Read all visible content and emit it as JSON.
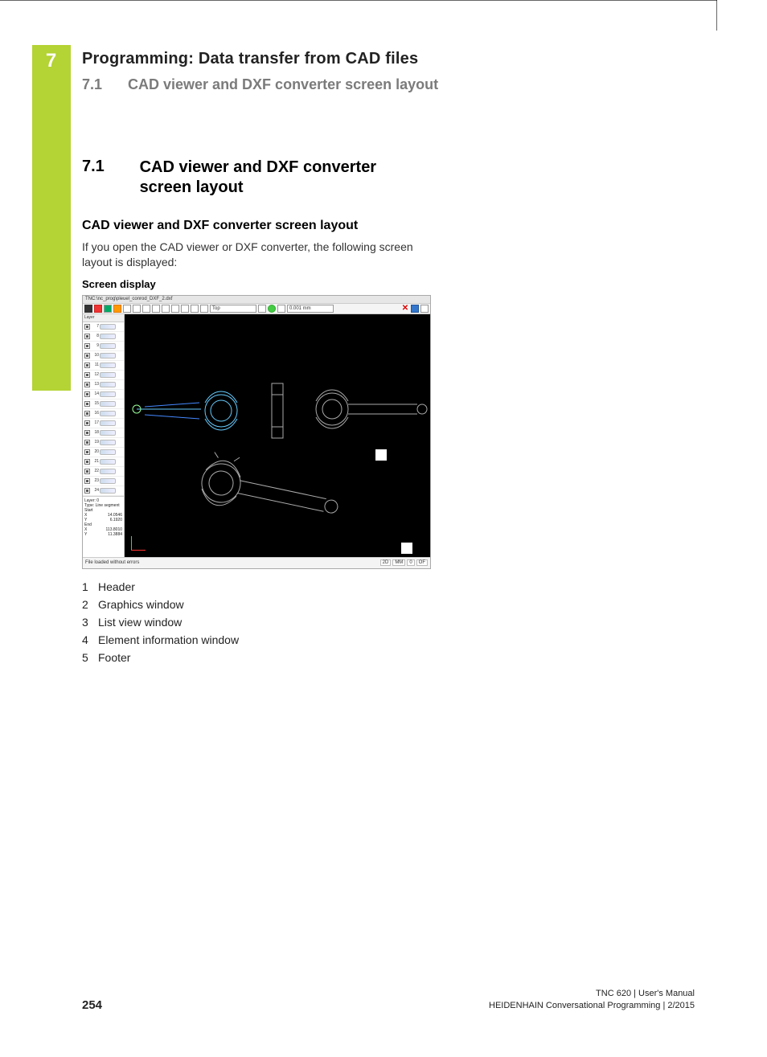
{
  "chapter_number": "7",
  "header": {
    "title": "Programming: Data transfer from CAD files",
    "sub_number": "7.1",
    "sub_title": "CAD viewer and DXF converter screen layout"
  },
  "section": {
    "number": "7.1",
    "title": "CAD viewer and DXF converter screen layout"
  },
  "subheading": "CAD viewer and DXF converter screen layout",
  "intro_para": "If you open the CAD viewer or DXF converter, the following screen layout is displayed:",
  "screen_display_label": "Screen display",
  "legend": [
    {
      "n": "1",
      "t": "Header"
    },
    {
      "n": "2",
      "t": "Graphics window"
    },
    {
      "n": "3",
      "t": "List view window"
    },
    {
      "n": "4",
      "t": "Element information window"
    },
    {
      "n": "5",
      "t": "Footer"
    }
  ],
  "screenshot": {
    "title_bar": "TNC:\\nc_prog\\pleuel_conrod_DXF_2.dxf",
    "view_select": "Top",
    "tolerance_readout": "0.001 mm",
    "layer_header": "Layer",
    "layers": [
      "7",
      "8",
      "9",
      "10",
      "11",
      "12",
      "13",
      "14",
      "15",
      "16",
      "17",
      "18",
      "19",
      "20",
      "21",
      "22",
      "23",
      "24"
    ],
    "info": {
      "layer_line": "Layer: 0",
      "type_line": "Type: Line segment",
      "start_label": "Start",
      "start_x_label": "X",
      "start_x": "14.0546",
      "start_y_label": "Y",
      "start_y": "6.1920",
      "end_label": "End",
      "end_x_label": "X",
      "end_x": "113.8010",
      "end_y_label": "Y",
      "end_y": "11.3884"
    },
    "footer_status": "File loaded without errors",
    "footer_cells": [
      "2D",
      "MM",
      "0",
      "OF"
    ]
  },
  "page_footer": {
    "page_number": "254",
    "line1": "TNC 620 | User's Manual",
    "line2": "HEIDENHAIN Conversational Programming | 2/2015"
  }
}
